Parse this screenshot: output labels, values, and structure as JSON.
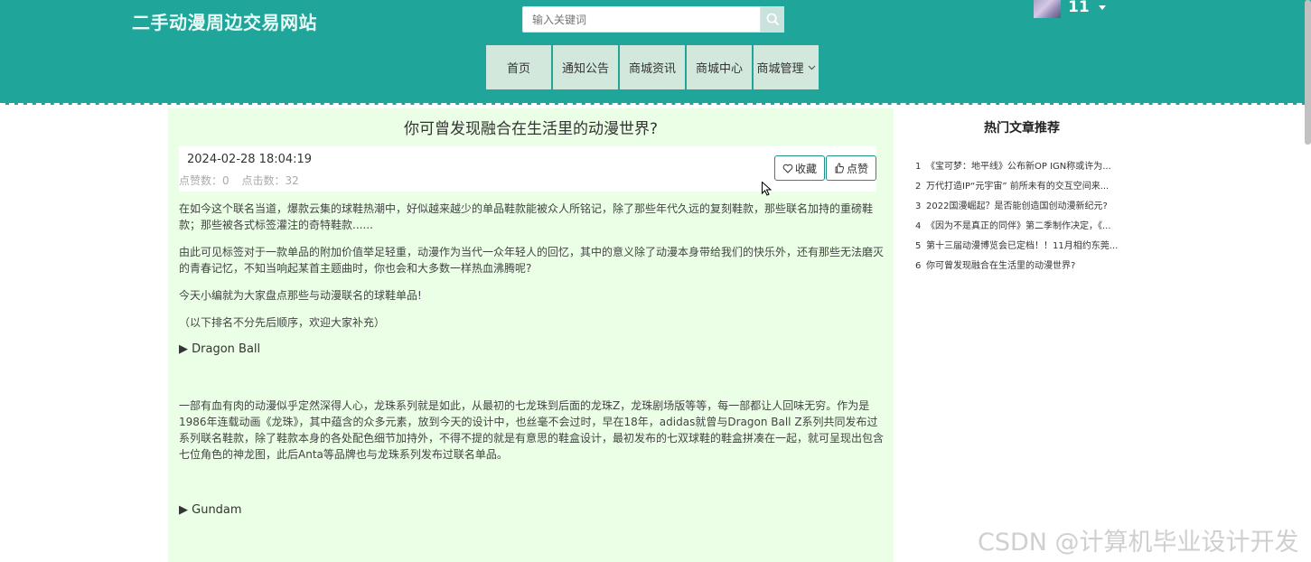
{
  "header": {
    "site_title": "二手动漫周边交易网站",
    "search_placeholder": "输入关键词",
    "username": "11"
  },
  "nav": {
    "items": [
      {
        "label": "首页"
      },
      {
        "label": "通知公告"
      },
      {
        "label": "商城资讯"
      },
      {
        "label": "商城中心"
      },
      {
        "label": "商城管理"
      }
    ]
  },
  "article": {
    "title": "你可曾发现融合在生活里的动漫世界?",
    "date": "2024-02-28 18:04:19",
    "likes_label": "点赞数：0",
    "clicks_label": "点击数：32",
    "favorite_label": "收藏",
    "like_label": "点赞",
    "paragraphs": [
      "在如今这个联名当道，爆款云集的球鞋热潮中，好似越来越少的单品鞋款能被众人所铭记，除了那些年代久远的复刻鞋款，那些联名加持的重磅鞋款；那些被各式标签灌注的奇特鞋款......",
      "由此可见标签对于一款单品的附加价值举足轻重，动漫作为当代一众年轻人的回忆，其中的意义除了动漫本身带给我们的快乐外，还有那些无法磨灭的青春记忆，不知当响起某首主题曲时，你也会和大多数一样热血沸腾呢?",
      "今天小编就为大家盘点那些与动漫联名的球鞋单品!",
      "（以下排名不分先后顺序，欢迎大家补充）"
    ],
    "section1": "▶ Dragon Ball",
    "section1_text": "一部有血有肉的动漫似乎定然深得人心，龙珠系列就是如此，从最初的七龙珠到后面的龙珠Z，龙珠剧场版等等，每一部都让人回味无穷。作为是1986年连载动画《龙珠》，其中蕴含的众多元素，放到今天的设计中，也丝毫不会过时，早在18年，adidas就曾与Dragon Ball Z系列共同发布过系列联名鞋款，除了鞋款本身的各处配色细节加持外，不得不提的就是有意思的鞋盒设计，最初发布的七双球鞋的鞋盒拼凑在一起，就可呈现出包含七位角色的神龙图，此后Anta等品牌也与龙珠系列发布过联名单品。",
    "section2": "▶ Gundam"
  },
  "sidebar": {
    "title": "热门文章推荐",
    "items": [
      {
        "num": "1",
        "text": "《宝可梦：地平线》公布新OP IGN称或许为..."
      },
      {
        "num": "2",
        "text": "万代打造IP“元宇宙” 前所未有的交互空间来..."
      },
      {
        "num": "3",
        "text": "2022国漫崛起？是否能创造国创动漫新纪元?"
      },
      {
        "num": "4",
        "text": "《因为不是真正的同伴》第二季制作决定，《..."
      },
      {
        "num": "5",
        "text": "第十三届动漫博览会已定档！！11月相约东莞..."
      },
      {
        "num": "6",
        "text": "你可曾发现融合在生活里的动漫世界?"
      }
    ]
  },
  "watermark": "CSDN @计算机毕业设计开发"
}
